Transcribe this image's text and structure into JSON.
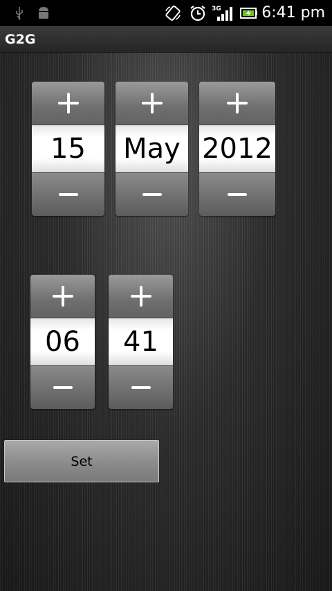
{
  "status_bar": {
    "time": "6:41 pm",
    "icons": [
      "usb-icon",
      "android-debug-icon",
      "rotate-icon",
      "alarm-icon",
      "signal-3g-icon",
      "battery-icon"
    ],
    "network_label": "3G"
  },
  "app": {
    "title": "G2G"
  },
  "date_picker": {
    "day": "15",
    "month": "May",
    "year": "2012"
  },
  "time_picker": {
    "hour": "06",
    "minute": "41"
  },
  "actions": {
    "set_label": "Set"
  },
  "colors": {
    "accent_green": "#6fbf2a",
    "background": "#2b2b2b"
  }
}
